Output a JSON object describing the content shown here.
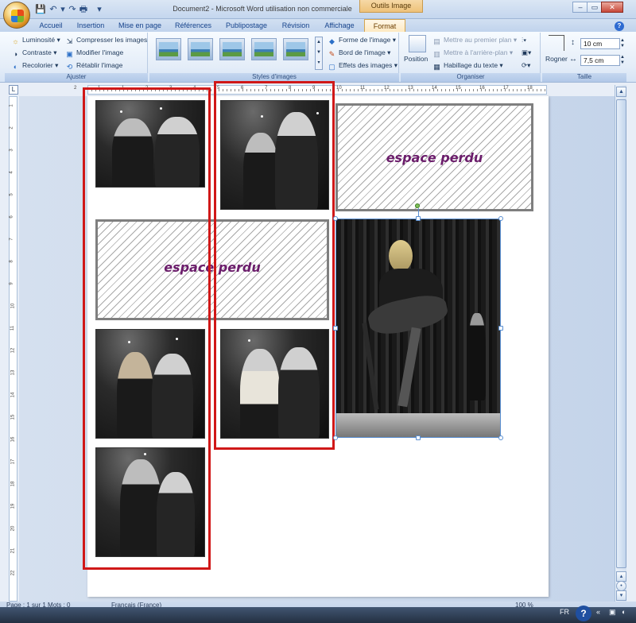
{
  "window": {
    "title": "Document2 - Microsoft Word utilisation non commerciale",
    "contextual_tab_title": "Outils Image"
  },
  "tabs": [
    {
      "label": "Accueil"
    },
    {
      "label": "Insertion"
    },
    {
      "label": "Mise en page"
    },
    {
      "label": "Références"
    },
    {
      "label": "Publipostage"
    },
    {
      "label": "Révision"
    },
    {
      "label": "Affichage"
    },
    {
      "label": "Format"
    }
  ],
  "ribbon": {
    "ajuster": {
      "label": "Ajuster",
      "luminosite": "Luminosité",
      "contraste": "Contraste",
      "recolorier": "Recolorier",
      "compresser": "Compresser les images",
      "modifier": "Modifier l'image",
      "retablir": "Rétablir l'image"
    },
    "styles": {
      "label": "Styles d'images",
      "forme": "Forme de l'image",
      "bord": "Bord de l'image",
      "effets": "Effets des images"
    },
    "organiser": {
      "label": "Organiser",
      "position": "Position",
      "premier_plan": "Mettre au premier plan",
      "arriere_plan": "Mettre à l'arrière-plan",
      "habillage": "Habillage du texte"
    },
    "taille": {
      "label": "Taille",
      "rogner": "Rogner",
      "height": "10 cm",
      "width": "7,5 cm"
    }
  },
  "ruler": {
    "h_numbers": [
      "2",
      "1",
      "1",
      "2",
      "3",
      "4",
      "5",
      "6",
      "7",
      "8",
      "9",
      "10",
      "11",
      "12",
      "13",
      "14",
      "15",
      "16",
      "17",
      "18"
    ],
    "v_numbers": [
      "1",
      "2",
      "3",
      "4",
      "5",
      "6",
      "7",
      "8",
      "9",
      "10",
      "11",
      "12",
      "13",
      "14",
      "15",
      "16",
      "17",
      "18",
      "19",
      "20",
      "21",
      "22"
    ]
  },
  "document": {
    "wasted_space_label_1": "espace perdu",
    "wasted_space_label_2": "espace perdu"
  },
  "statusbar": {
    "text": "Page : 1 sur 1    Mots : 0",
    "language": "Français (France)",
    "zoom": "100 %",
    "tray_lang": "FR"
  },
  "colors": {
    "outline_red": "#d01818",
    "label_purple": "#6b1d6b",
    "hatch_border": "#7f7f7f"
  }
}
